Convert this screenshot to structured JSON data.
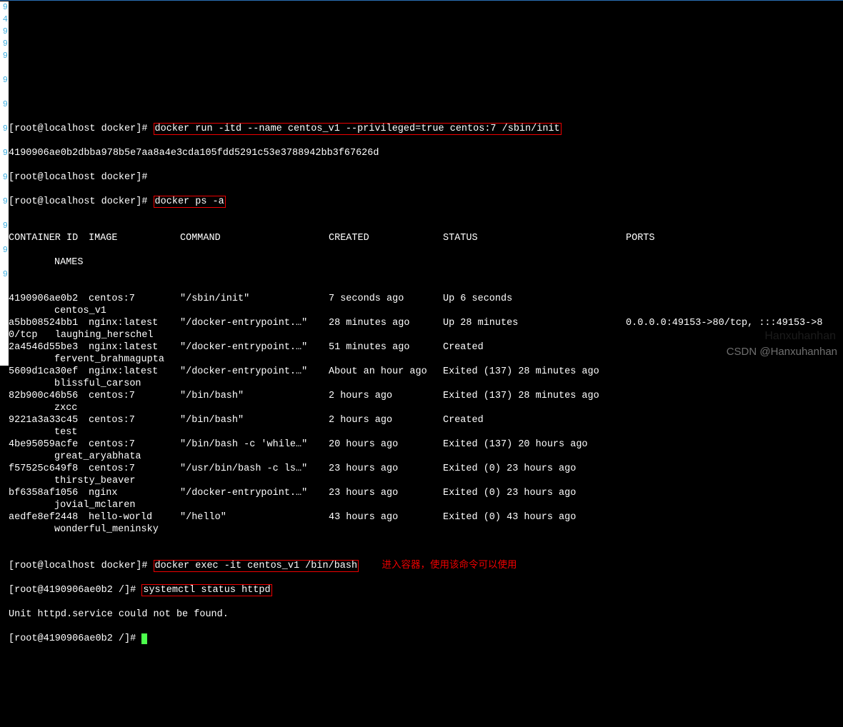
{
  "gutter": [
    "9",
    "4",
    "9",
    "9",
    "9",
    "",
    "9",
    "",
    "9",
    "",
    "9",
    "",
    "9",
    "",
    "9",
    "",
    "9",
    "",
    "9",
    "",
    "9",
    "",
    "9",
    "",
    "",
    "",
    "",
    "",
    "",
    ""
  ],
  "prompt_host": "[root@localhost docker]#",
  "prompt_container": "[root@4190906ae0b2 /]#",
  "cmd1": "docker run -itd --name centos_v1 --privileged=true centos:7 /sbin/init",
  "cmd1_output": "4190906ae0b2dbba978b5e7aa8a4e3cda105fdd5291c53e3788942bb3f67626d",
  "cmd2": "docker ps -a",
  "headers": {
    "id": "CONTAINER ID",
    "image": "IMAGE",
    "command": "COMMAND",
    "created": "CREATED",
    "status": "STATUS",
    "ports": "PORTS",
    "names": "NAMES"
  },
  "rows": [
    {
      "id": "4190906ae0b2",
      "image": "centos:7",
      "command": "\"/sbin/init\"",
      "created": "7 seconds ago",
      "status": "Up 6 seconds",
      "ports": "",
      "name": "centos_v1"
    },
    {
      "id": "a5bb08524bb1",
      "image": "nginx:latest",
      "command": "\"/docker-entrypoint.…\"",
      "created": "28 minutes ago",
      "status": "Up 28 minutes",
      "ports": "0.0.0.0:49153->80/tcp, :::49153->8",
      "name": "0/tcp   laughing_herschel"
    },
    {
      "id": "2a4546d55be3",
      "image": "nginx:latest",
      "command": "\"/docker-entrypoint.…\"",
      "created": "51 minutes ago",
      "status": "Created",
      "ports": "",
      "name": "fervent_brahmagupta"
    },
    {
      "id": "5609d1ca30ef",
      "image": "nginx:latest",
      "command": "\"/docker-entrypoint.…\"",
      "created": "About an hour ago",
      "status": "Exited (137) 28 minutes ago",
      "ports": "",
      "name": "blissful_carson"
    },
    {
      "id": "82b900c46b56",
      "image": "centos:7",
      "command": "\"/bin/bash\"",
      "created": "2 hours ago",
      "status": "Exited (137) 28 minutes ago",
      "ports": "",
      "name": "zxcc"
    },
    {
      "id": "9221a3a33c45",
      "image": "centos:7",
      "command": "\"/bin/bash\"",
      "created": "2 hours ago",
      "status": "Created",
      "ports": "",
      "name": "test"
    },
    {
      "id": "4be95059acfe",
      "image": "centos:7",
      "command": "\"/bin/bash -c 'while…\"",
      "created": "20 hours ago",
      "status": "Exited (137) 20 hours ago",
      "ports": "",
      "name": "great_aryabhata"
    },
    {
      "id": "f57525c649f8",
      "image": "centos:7",
      "command": "\"/usr/bin/bash -c ls…\"",
      "created": "23 hours ago",
      "status": "Exited (0) 23 hours ago",
      "ports": "",
      "name": "thirsty_beaver"
    },
    {
      "id": "bf6358af1056",
      "image": "nginx",
      "command": "\"/docker-entrypoint.…\"",
      "created": "23 hours ago",
      "status": "Exited (0) 23 hours ago",
      "ports": "",
      "name": "jovial_mclaren"
    },
    {
      "id": "aedfe8ef2448",
      "image": "hello-world",
      "command": "\"/hello\"",
      "created": "43 hours ago",
      "status": "Exited (0) 43 hours ago",
      "ports": "",
      "name": "wonderful_meninsky"
    }
  ],
  "cmd3": "docker exec -it centos_v1 /bin/bash",
  "annotation": "进入容器，使用该命令可以使用",
  "cmd4": "systemctl status httpd",
  "cmd4_output": "Unit httpd.service could not be found.",
  "watermark": "CSDN @Hanxuhanhan"
}
